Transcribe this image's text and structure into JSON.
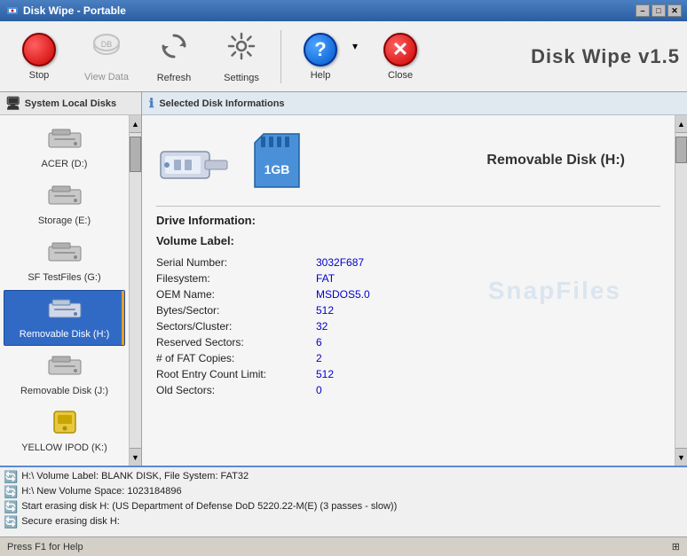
{
  "titlebar": {
    "title": "Disk Wipe - Portable",
    "min_label": "–",
    "max_label": "□",
    "close_label": "✕"
  },
  "toolbar": {
    "stop_label": "Stop",
    "viewdata_label": "View Data",
    "refresh_label": "Refresh",
    "settings_label": "Settings",
    "help_label": "Help",
    "close_label": "Close",
    "app_title": "Disk Wipe v1.5"
  },
  "sidebar": {
    "header": "System Local Disks",
    "disks": [
      {
        "id": "acer",
        "label": "ACER (D:)",
        "selected": false
      },
      {
        "id": "storage",
        "label": "Storage (E:)",
        "selected": false
      },
      {
        "id": "sftestfiles",
        "label": "SF TestFiles (G:)",
        "selected": false
      },
      {
        "id": "removable-h",
        "label": "Removable Disk (H:)",
        "selected": true
      },
      {
        "id": "removable-j",
        "label": "Removable Disk (J:)",
        "selected": false
      },
      {
        "id": "yellowipod",
        "label": "YELLOW IPOD (K:)",
        "selected": false
      }
    ]
  },
  "content": {
    "header": "Selected Disk Informations",
    "disk_name": "Removable Disk  (H:)",
    "drive_info_title": "Drive Information:",
    "volume_label_title": "Volume Label:",
    "fields": [
      {
        "key": "Serial Number:",
        "value": "3032F687"
      },
      {
        "key": "Filesystem:",
        "value": "FAT"
      },
      {
        "key": "OEM Name:",
        "value": "MSDOS5.0"
      },
      {
        "key": "Bytes/Sector:",
        "value": "512"
      },
      {
        "key": "Sectors/Cluster:",
        "value": "32"
      },
      {
        "key": "Reserved Sectors:",
        "value": "6"
      },
      {
        "key": "# of FAT Copies:",
        "value": "2"
      },
      {
        "key": "Root Entry Count Limit:",
        "value": "512"
      },
      {
        "key": "Old Sectors:",
        "value": "0"
      }
    ],
    "watermark": "SnapFiles"
  },
  "log": {
    "lines": [
      "H:\\ Volume Label: BLANK DISK, File System: FAT32",
      "H:\\ New Volume Space: 1023184896",
      "Start erasing disk H: (US Department of Defense DoD 5220.22-M(E) (3 passes - slow))",
      "Secure erasing disk H:"
    ]
  },
  "statusbar": {
    "help_text": "Press F1 for Help",
    "right_text": "⊞"
  }
}
